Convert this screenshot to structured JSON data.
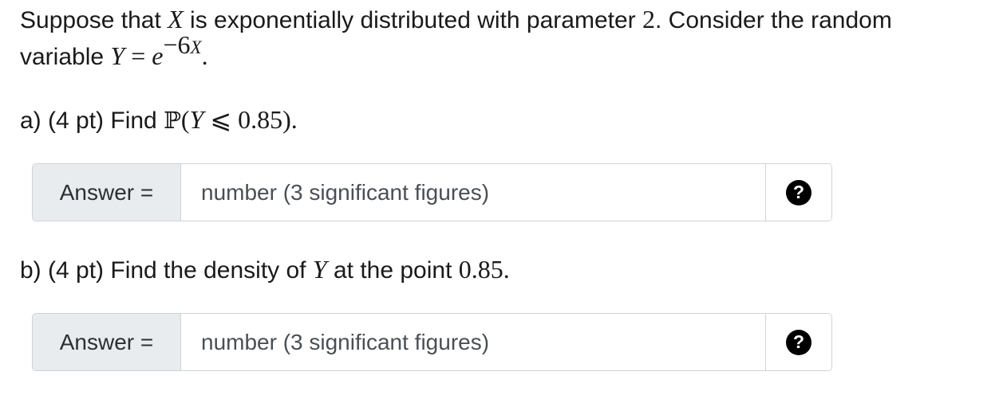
{
  "problem": {
    "intro_1": "Suppose that ",
    "var_X": "X",
    "intro_2": " is exponentially distributed with parameter ",
    "param": "2",
    "intro_3": ". Consider the random",
    "intro_4": "variable ",
    "var_Y": "Y",
    "equals": "=",
    "base_e": "e",
    "exponent_coeff": "−6",
    "exponent_var": "X",
    "intro_end": "."
  },
  "part_a": {
    "label": "a) (4 pt) Find ",
    "prob_symbol": "ℙ",
    "open_paren": "(",
    "var": "Y",
    "leq": "⩽",
    "value": "0.85",
    "close": ")."
  },
  "part_b": {
    "label_1": "b) (4 pt) Find the density of ",
    "var": "Y",
    "label_2": " at the point ",
    "value": "0.85",
    "end": "."
  },
  "answer_a": {
    "prefix": "Answer =",
    "placeholder": "number (3 significant figures)",
    "value": "",
    "help_icon": "question-circle-icon"
  },
  "answer_b": {
    "prefix": "Answer =",
    "placeholder": "number (3 significant figures)",
    "value": "",
    "help_icon": "question-circle-icon"
  }
}
